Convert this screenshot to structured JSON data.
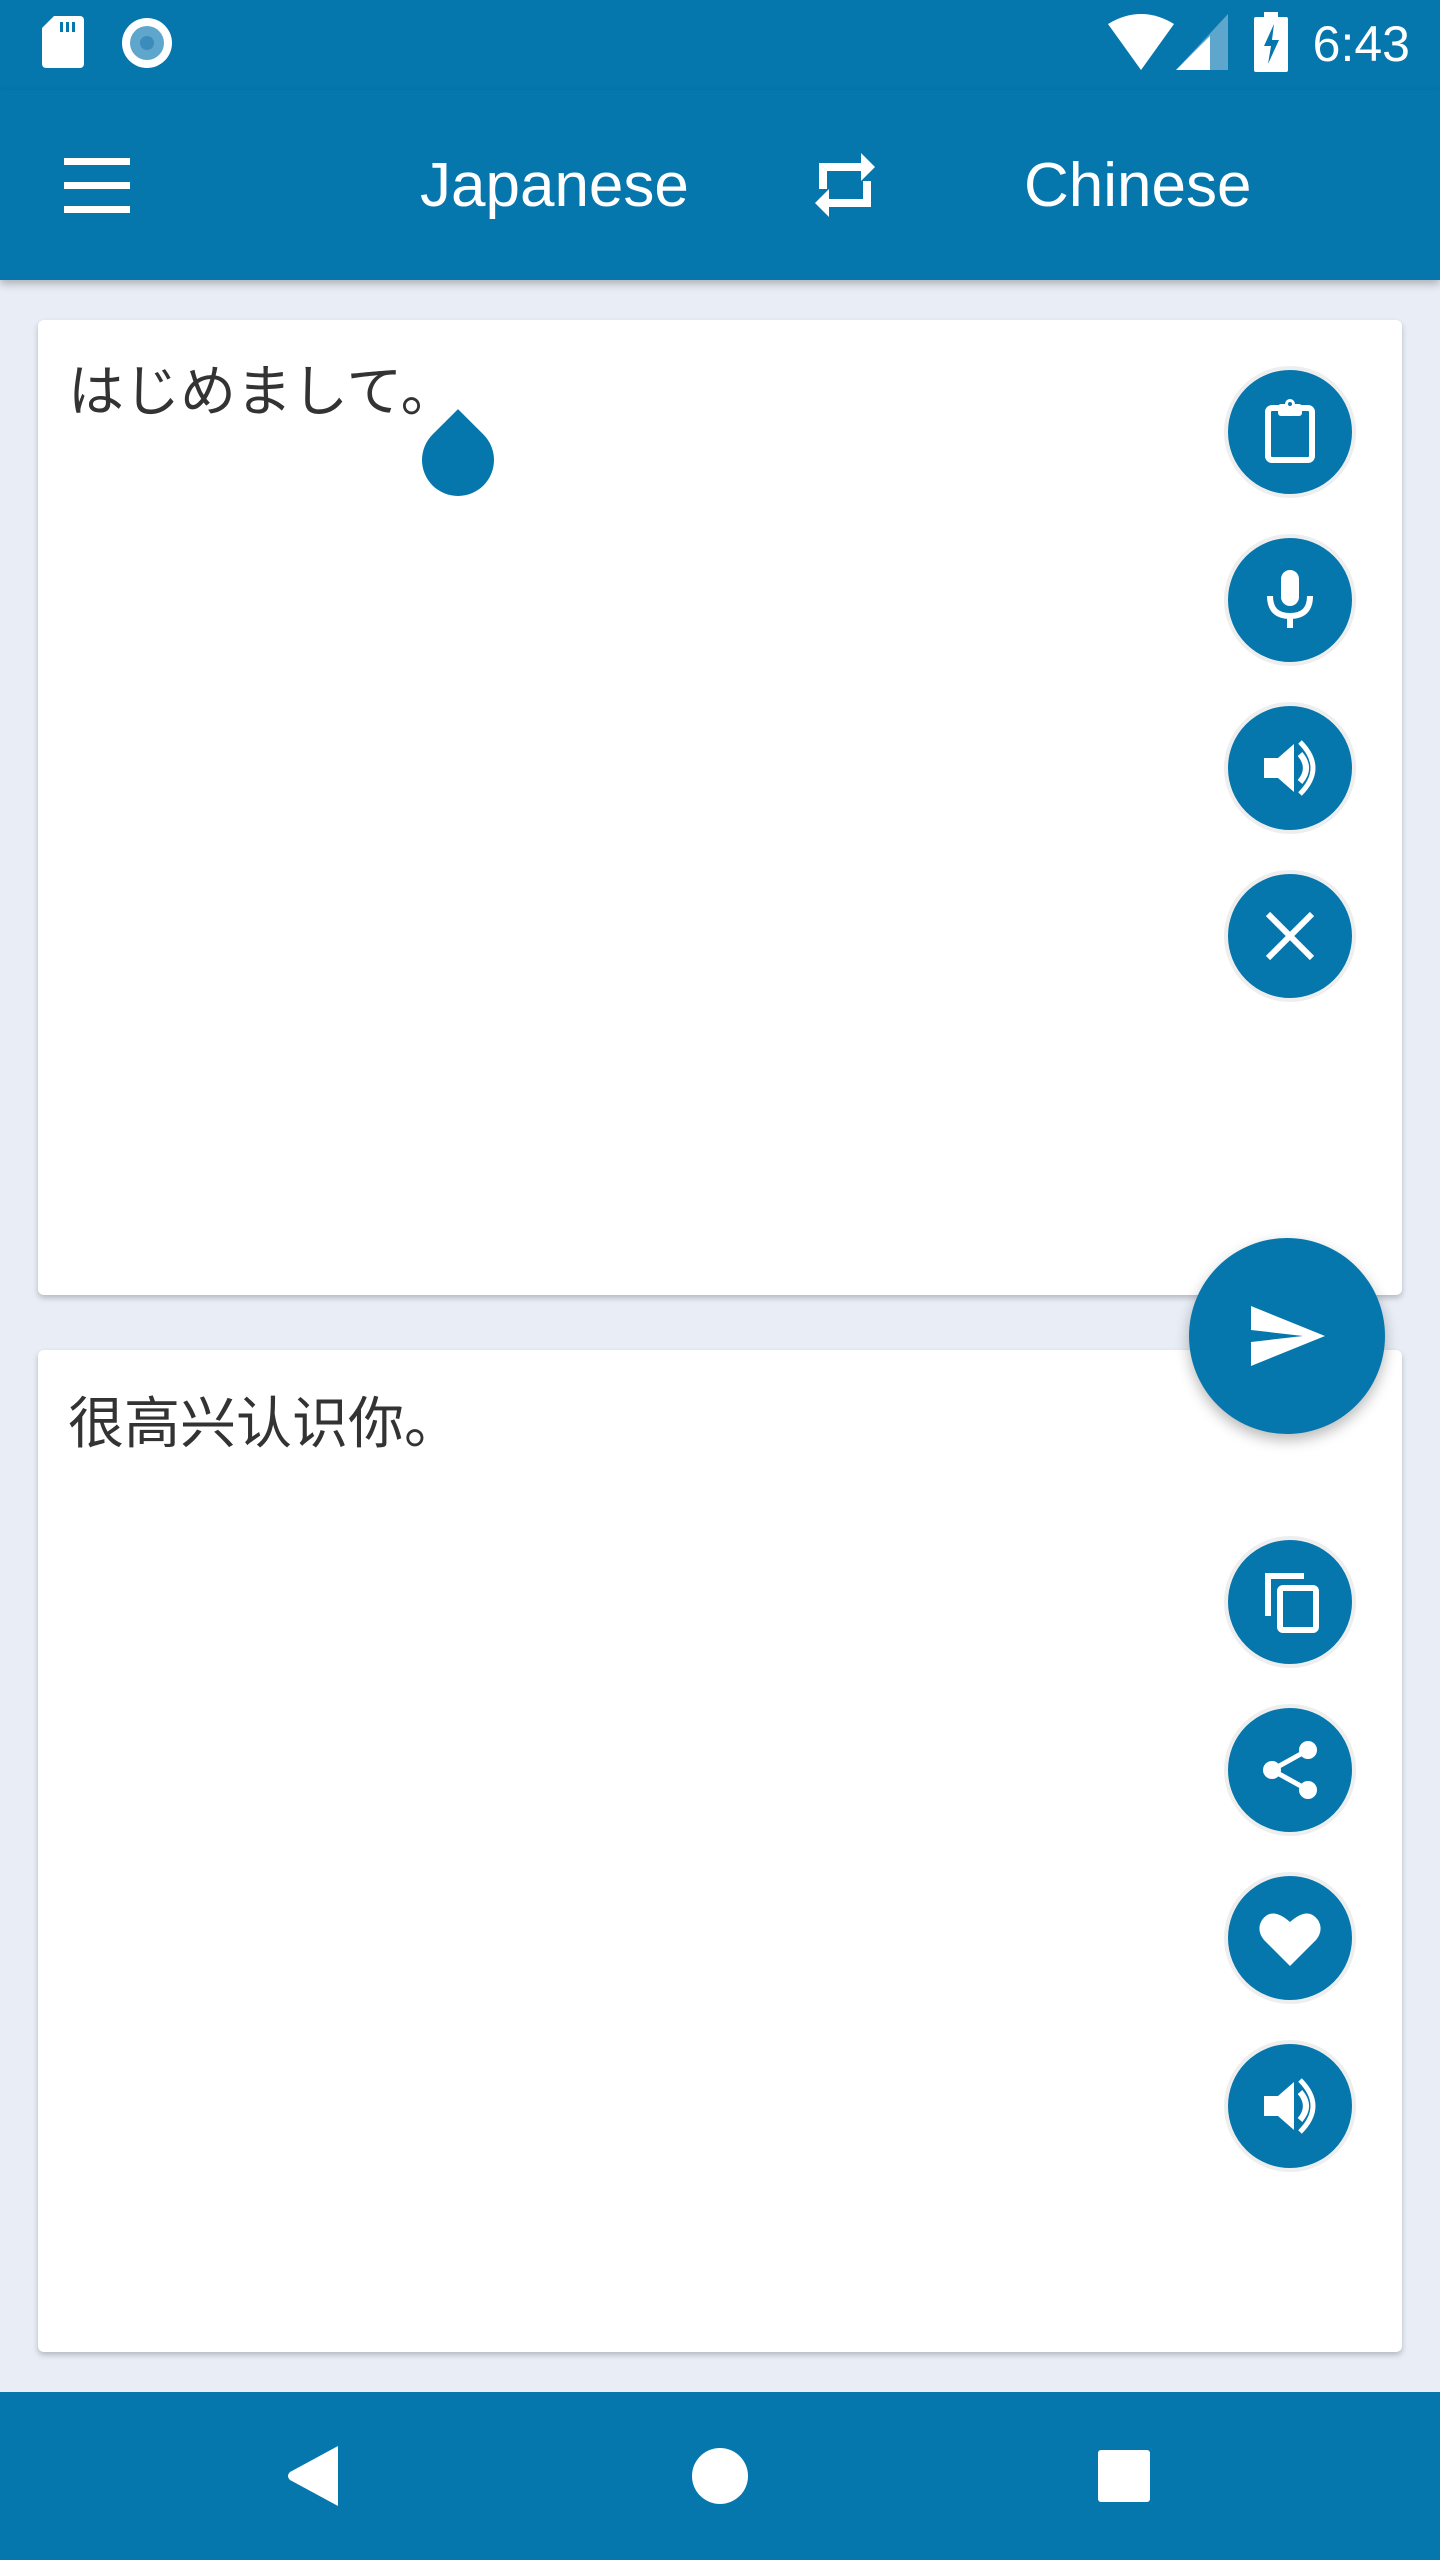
{
  "status_bar": {
    "time": "6:43",
    "left_icons": [
      "sd-card-icon",
      "record-icon"
    ],
    "right_icons": [
      "wifi-icon",
      "cell-signal-icon",
      "battery-charging-icon"
    ]
  },
  "app_bar": {
    "menu_icon": "menu-icon",
    "source_language": "Japanese",
    "swap_icon": "swap-languages-icon",
    "target_language": "Chinese"
  },
  "input_card": {
    "text": "はじめまして。",
    "actions": [
      {
        "name": "paste",
        "icon": "clipboard-icon"
      },
      {
        "name": "voice-input",
        "icon": "microphone-icon"
      },
      {
        "name": "speak-input",
        "icon": "speaker-icon"
      },
      {
        "name": "clear",
        "icon": "close-icon"
      }
    ]
  },
  "translate_button": {
    "icon": "send-icon"
  },
  "output_card": {
    "text": "很高兴认识你。",
    "actions": [
      {
        "name": "copy",
        "icon": "copy-icon"
      },
      {
        "name": "share",
        "icon": "share-icon"
      },
      {
        "name": "favorite",
        "icon": "heart-icon"
      },
      {
        "name": "speak-output",
        "icon": "speaker-icon"
      }
    ]
  },
  "nav_bar": {
    "buttons": [
      "back",
      "home",
      "recents"
    ]
  },
  "colors": {
    "primary": "#0677ac",
    "background": "#e8edf6",
    "card": "#ffffff",
    "text": "#333333"
  }
}
